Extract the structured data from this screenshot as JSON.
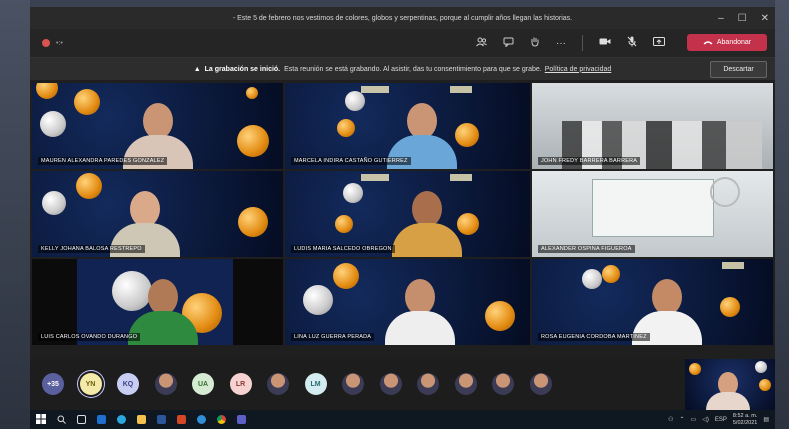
{
  "window": {
    "title": "- Este 5 de febrero nos vestimos de colores, globos y serpentinas, porque al cumplir años llegan las historias.",
    "min": "–",
    "max": "☐",
    "close": "✕"
  },
  "toolbar": {
    "leave_label": "Abandonar",
    "more": "···"
  },
  "banner": {
    "bold": "La grabación se inició.",
    "text": "Esta reunión se está grabando. Al asistir, das tu consentimiento para que se grabe.",
    "link": "Política de privacidad",
    "dismiss": "Descartar"
  },
  "participants": [
    {
      "name": "MAUREN ALEXANDRA PAREDES GONZALEZ"
    },
    {
      "name": "MARCELA INDIRA CASTAÑO GUTIERREZ"
    },
    {
      "name": "JOHN FREDY BARRERA BARRERA"
    },
    {
      "name": "KELLY JOHANA BALOSA RESTREPO"
    },
    {
      "name": "LUDIS MARIA SALCEDO OBREGON"
    },
    {
      "name": "ALEXANDER OSPINA FIGUEROA"
    },
    {
      "name": "LUIS CARLOS OVANDO DURANGO"
    },
    {
      "name": "LINA LUZ GUERRA PERADA"
    },
    {
      "name": "ROSA EUGENIA CORDOBA MARTINEZ"
    }
  ],
  "strip": [
    {
      "label": "+35",
      "bg": "#5a5f9e",
      "fg": "#ffffff"
    },
    {
      "label": "YN",
      "bg": "#f4eaa8",
      "fg": "#6b5c10"
    },
    {
      "label": "KQ",
      "bg": "#c8cdf2",
      "fg": "#3b4086"
    },
    {
      "label": "",
      "bg": "",
      "fg": ""
    },
    {
      "label": "UA",
      "bg": "#d6ecd2",
      "fg": "#3b6b34"
    },
    {
      "label": "LR",
      "bg": "#f6d3d0",
      "fg": "#8a3a33"
    },
    {
      "label": "",
      "bg": "",
      "fg": ""
    },
    {
      "label": "LM",
      "bg": "#d2ecef",
      "fg": "#2a6a70"
    },
    {
      "label": "",
      "bg": "",
      "fg": ""
    },
    {
      "label": "",
      "bg": "",
      "fg": ""
    },
    {
      "label": "",
      "bg": "",
      "fg": ""
    },
    {
      "label": "",
      "bg": "",
      "fg": ""
    },
    {
      "label": "",
      "bg": "",
      "fg": ""
    },
    {
      "label": "",
      "bg": "",
      "fg": ""
    }
  ],
  "taskbar": {
    "lang": "ESP",
    "time": "8:52 a. m.",
    "date": "5/02/2021"
  },
  "colors": {
    "leave": "#c4314b",
    "recording": "#d9534f"
  }
}
